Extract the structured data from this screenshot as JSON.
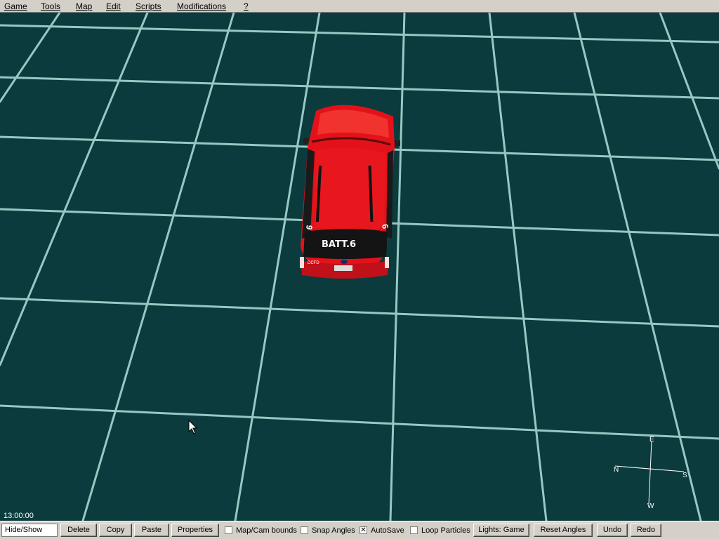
{
  "menu": {
    "items": [
      {
        "label": "Game"
      },
      {
        "label": "Tools"
      },
      {
        "label": "Map"
      },
      {
        "label": "Edit"
      },
      {
        "label": "Scripts"
      },
      {
        "label": "Modifications"
      },
      {
        "label": "?"
      }
    ]
  },
  "viewport": {
    "background_color": "#0b3b3d",
    "grid_color": "#a8d8d2",
    "vehicle": {
      "color": "#e3121a",
      "rear_label": "BATT.6",
      "side_text": "DCFD"
    },
    "compass": {
      "top": "E",
      "left": "N",
      "right": "S",
      "bottom": "W"
    }
  },
  "status": {
    "time": "13:00:00"
  },
  "toolbar": {
    "hide_show_value": "Hide/Show",
    "delete_label": "Delete",
    "copy_label": "Copy",
    "paste_label": "Paste",
    "properties_label": "Properties",
    "map_cam_bounds_label": "Map/Cam bounds",
    "map_cam_bounds_checked": false,
    "snap_angles_label": "Snap Angles",
    "snap_angles_checked": false,
    "autosave_label": "AutoSave",
    "autosave_checked": true,
    "loop_particles_label": "Loop Particles",
    "loop_particles_checked": false,
    "lights_label": "Lights: Game",
    "reset_angles_label": "Reset Angles",
    "undo_label": "Undo",
    "redo_label": "Redo"
  }
}
